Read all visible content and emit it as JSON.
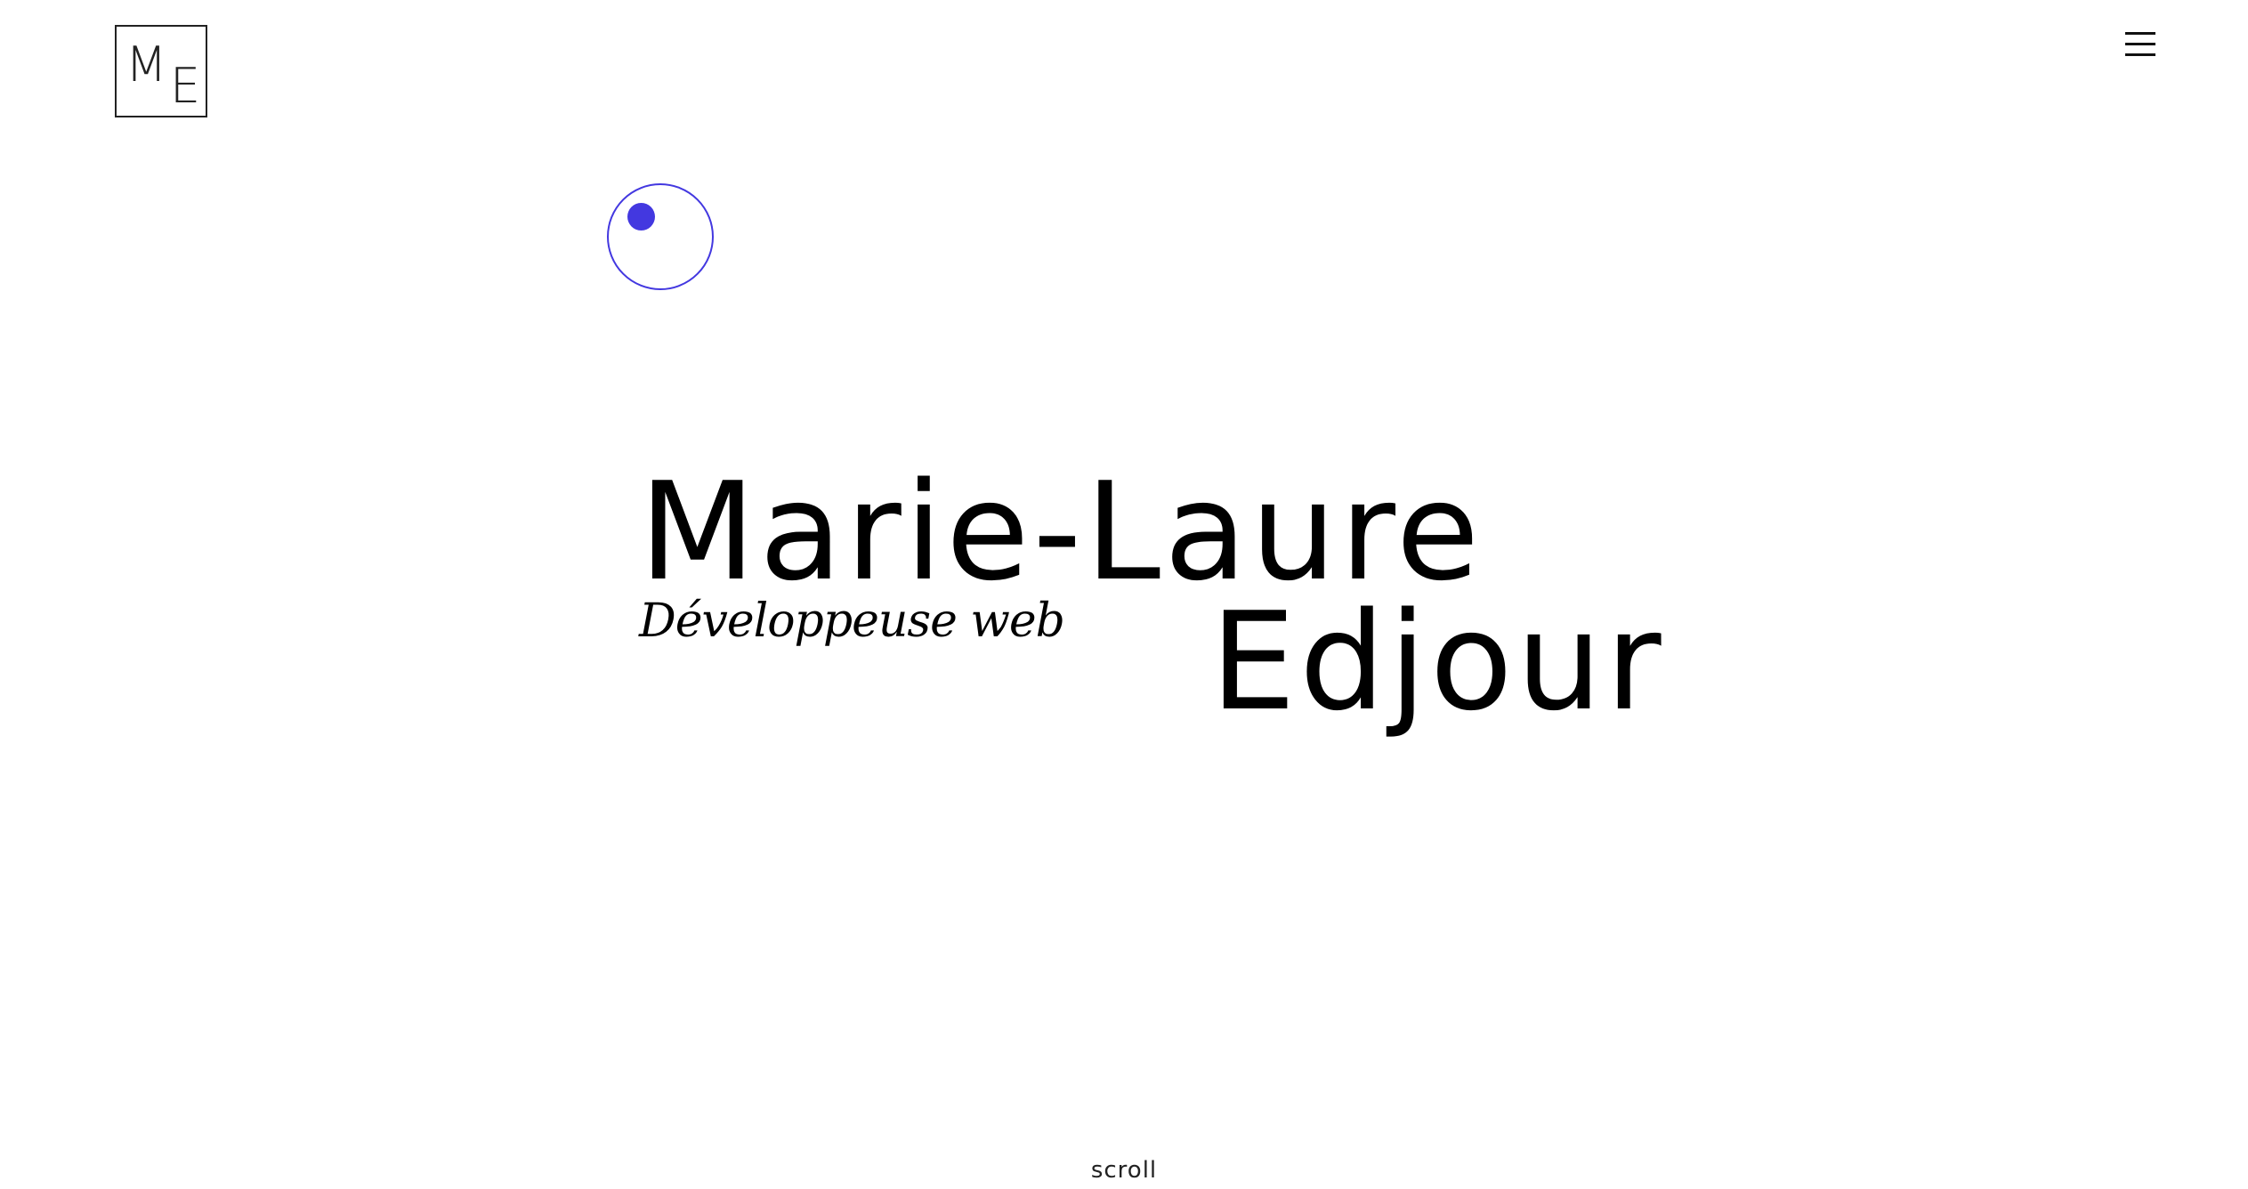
{
  "header": {
    "logo": {
      "letter_1": "M",
      "letter_2": "E"
    },
    "menu_icon": "hamburger-menu-icon"
  },
  "hero": {
    "first_name": "Marie-Laure",
    "subtitle": "Développeuse web",
    "last_name": "Edjour"
  },
  "cursor": {
    "color": "#4338e0"
  },
  "footer": {
    "scroll_label": "scroll"
  }
}
